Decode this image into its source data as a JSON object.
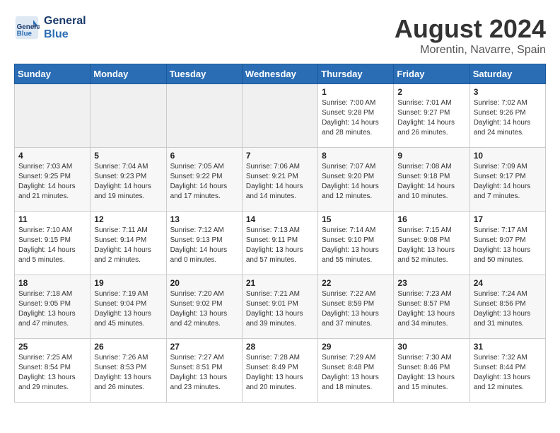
{
  "header": {
    "logo_line1": "General",
    "logo_line2": "Blue",
    "month": "August 2024",
    "location": "Morentin, Navarre, Spain"
  },
  "weekdays": [
    "Sunday",
    "Monday",
    "Tuesday",
    "Wednesday",
    "Thursday",
    "Friday",
    "Saturday"
  ],
  "weeks": [
    [
      {
        "day": "",
        "info": ""
      },
      {
        "day": "",
        "info": ""
      },
      {
        "day": "",
        "info": ""
      },
      {
        "day": "",
        "info": ""
      },
      {
        "day": "1",
        "info": "Sunrise: 7:00 AM\nSunset: 9:28 PM\nDaylight: 14 hours\nand 28 minutes."
      },
      {
        "day": "2",
        "info": "Sunrise: 7:01 AM\nSunset: 9:27 PM\nDaylight: 14 hours\nand 26 minutes."
      },
      {
        "day": "3",
        "info": "Sunrise: 7:02 AM\nSunset: 9:26 PM\nDaylight: 14 hours\nand 24 minutes."
      }
    ],
    [
      {
        "day": "4",
        "info": "Sunrise: 7:03 AM\nSunset: 9:25 PM\nDaylight: 14 hours\nand 21 minutes."
      },
      {
        "day": "5",
        "info": "Sunrise: 7:04 AM\nSunset: 9:23 PM\nDaylight: 14 hours\nand 19 minutes."
      },
      {
        "day": "6",
        "info": "Sunrise: 7:05 AM\nSunset: 9:22 PM\nDaylight: 14 hours\nand 17 minutes."
      },
      {
        "day": "7",
        "info": "Sunrise: 7:06 AM\nSunset: 9:21 PM\nDaylight: 14 hours\nand 14 minutes."
      },
      {
        "day": "8",
        "info": "Sunrise: 7:07 AM\nSunset: 9:20 PM\nDaylight: 14 hours\nand 12 minutes."
      },
      {
        "day": "9",
        "info": "Sunrise: 7:08 AM\nSunset: 9:18 PM\nDaylight: 14 hours\nand 10 minutes."
      },
      {
        "day": "10",
        "info": "Sunrise: 7:09 AM\nSunset: 9:17 PM\nDaylight: 14 hours\nand 7 minutes."
      }
    ],
    [
      {
        "day": "11",
        "info": "Sunrise: 7:10 AM\nSunset: 9:15 PM\nDaylight: 14 hours\nand 5 minutes."
      },
      {
        "day": "12",
        "info": "Sunrise: 7:11 AM\nSunset: 9:14 PM\nDaylight: 14 hours\nand 2 minutes."
      },
      {
        "day": "13",
        "info": "Sunrise: 7:12 AM\nSunset: 9:13 PM\nDaylight: 14 hours\nand 0 minutes."
      },
      {
        "day": "14",
        "info": "Sunrise: 7:13 AM\nSunset: 9:11 PM\nDaylight: 13 hours\nand 57 minutes."
      },
      {
        "day": "15",
        "info": "Sunrise: 7:14 AM\nSunset: 9:10 PM\nDaylight: 13 hours\nand 55 minutes."
      },
      {
        "day": "16",
        "info": "Sunrise: 7:15 AM\nSunset: 9:08 PM\nDaylight: 13 hours\nand 52 minutes."
      },
      {
        "day": "17",
        "info": "Sunrise: 7:17 AM\nSunset: 9:07 PM\nDaylight: 13 hours\nand 50 minutes."
      }
    ],
    [
      {
        "day": "18",
        "info": "Sunrise: 7:18 AM\nSunset: 9:05 PM\nDaylight: 13 hours\nand 47 minutes."
      },
      {
        "day": "19",
        "info": "Sunrise: 7:19 AM\nSunset: 9:04 PM\nDaylight: 13 hours\nand 45 minutes."
      },
      {
        "day": "20",
        "info": "Sunrise: 7:20 AM\nSunset: 9:02 PM\nDaylight: 13 hours\nand 42 minutes."
      },
      {
        "day": "21",
        "info": "Sunrise: 7:21 AM\nSunset: 9:01 PM\nDaylight: 13 hours\nand 39 minutes."
      },
      {
        "day": "22",
        "info": "Sunrise: 7:22 AM\nSunset: 8:59 PM\nDaylight: 13 hours\nand 37 minutes."
      },
      {
        "day": "23",
        "info": "Sunrise: 7:23 AM\nSunset: 8:57 PM\nDaylight: 13 hours\nand 34 minutes."
      },
      {
        "day": "24",
        "info": "Sunrise: 7:24 AM\nSunset: 8:56 PM\nDaylight: 13 hours\nand 31 minutes."
      }
    ],
    [
      {
        "day": "25",
        "info": "Sunrise: 7:25 AM\nSunset: 8:54 PM\nDaylight: 13 hours\nand 29 minutes."
      },
      {
        "day": "26",
        "info": "Sunrise: 7:26 AM\nSunset: 8:53 PM\nDaylight: 13 hours\nand 26 minutes."
      },
      {
        "day": "27",
        "info": "Sunrise: 7:27 AM\nSunset: 8:51 PM\nDaylight: 13 hours\nand 23 minutes."
      },
      {
        "day": "28",
        "info": "Sunrise: 7:28 AM\nSunset: 8:49 PM\nDaylight: 13 hours\nand 20 minutes."
      },
      {
        "day": "29",
        "info": "Sunrise: 7:29 AM\nSunset: 8:48 PM\nDaylight: 13 hours\nand 18 minutes."
      },
      {
        "day": "30",
        "info": "Sunrise: 7:30 AM\nSunset: 8:46 PM\nDaylight: 13 hours\nand 15 minutes."
      },
      {
        "day": "31",
        "info": "Sunrise: 7:32 AM\nSunset: 8:44 PM\nDaylight: 13 hours\nand 12 minutes."
      }
    ]
  ]
}
